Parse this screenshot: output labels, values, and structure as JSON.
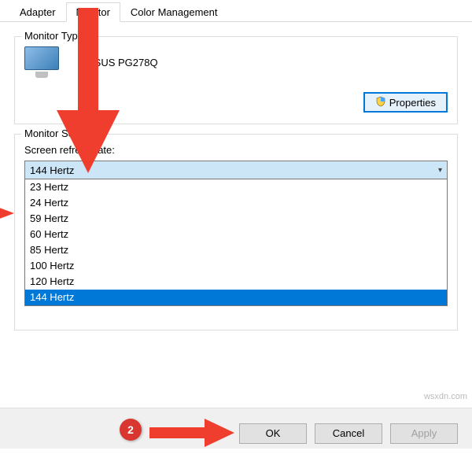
{
  "tabs": {
    "adapter": "Adapter",
    "monitor": "Monitor",
    "color": "Color Management"
  },
  "group_monitor_type": {
    "title": "Monitor Type",
    "device_name": "ASUS PG278Q",
    "properties_btn": "Properties"
  },
  "group_monitor_settings": {
    "title": "Monitor Settings",
    "refresh_label": "Screen refresh rate:",
    "selected": "144 Hertz",
    "options": [
      "23 Hertz",
      "24 Hertz",
      "59 Hertz",
      "60 Hertz",
      "85 Hertz",
      "100 Hertz",
      "120 Hertz",
      "144 Hertz"
    ]
  },
  "buttons": {
    "ok": "OK",
    "cancel": "Cancel",
    "apply": "Apply"
  },
  "annotations": {
    "badge2": "2"
  },
  "watermark": "wsxdn.com"
}
